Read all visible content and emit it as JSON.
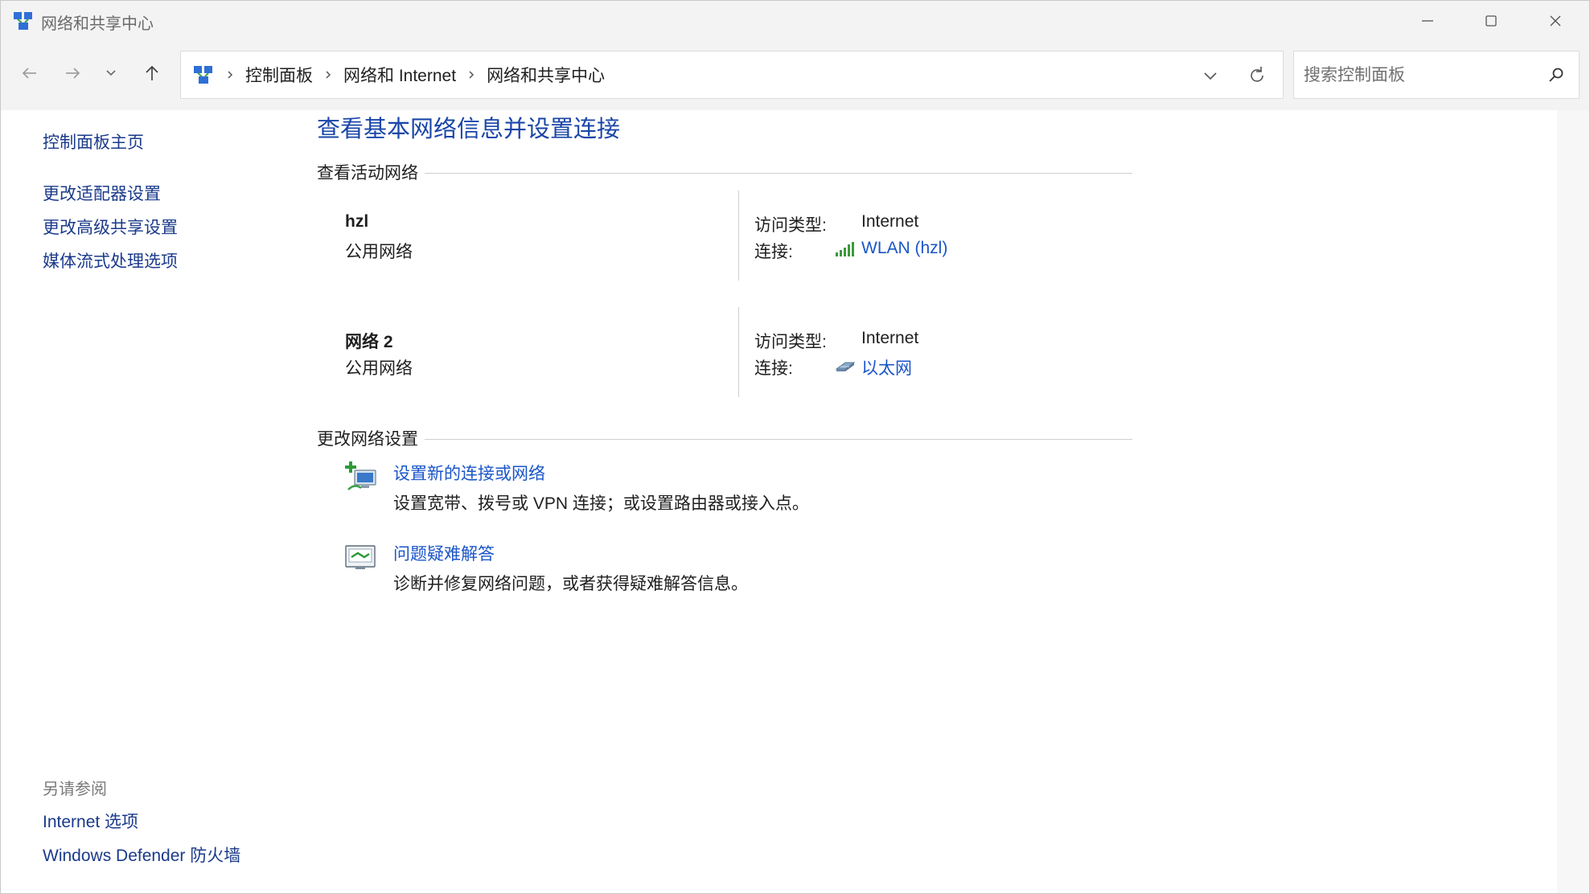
{
  "window": {
    "title": "网络和共享中心",
    "icon": "network-center-icon"
  },
  "navbar": {
    "back_icon": "arrow-left-icon",
    "forward_icon": "arrow-right-icon",
    "recent_icon": "chevron-down-icon",
    "up_icon": "arrow-up-icon",
    "breadcrumb": [
      "控制面板",
      "网络和 Internet",
      "网络和共享中心"
    ],
    "search": {
      "placeholder": "搜索控制面板",
      "value": ""
    }
  },
  "sidebar": {
    "home": "控制面板主页",
    "links": [
      "更改适配器设置",
      "更改高级共享设置",
      "媒体流式处理选项"
    ],
    "see_also_heading": "另请参阅",
    "see_also": [
      "Internet 选项",
      "Windows Defender 防火墙"
    ]
  },
  "main": {
    "title": "查看基本网络信息并设置连接",
    "active_networks_label": "查看活动网络",
    "networks": [
      {
        "name": "hzl",
        "type": "公用网络",
        "access_label": "访问类型:",
        "access_value": "Internet",
        "connection_label": "连接:",
        "connection_value": "WLAN (hzl)",
        "connection_icon": "wifi-signal-icon"
      },
      {
        "name": "网络 2",
        "type": "公用网络",
        "access_label": "访问类型:",
        "access_value": "Internet",
        "connection_label": "连接:",
        "connection_value": "以太网",
        "connection_icon": "ethernet-icon"
      }
    ],
    "change_settings_label": "更改网络设置",
    "tasks": [
      {
        "title": "设置新的连接或网络",
        "description": "设置宽带、拨号或 VPN 连接；或设置路由器或接入点。",
        "icon": "new-connection-icon"
      },
      {
        "title": "问题疑难解答",
        "description": "诊断并修复网络问题，或者获得疑难解答信息。",
        "icon": "troubleshoot-icon"
      }
    ]
  },
  "colors": {
    "link": "#1a55c8",
    "title": "#1a46a8",
    "sidebar_link": "#1a3a8a",
    "chrome": "#f3f3f3"
  }
}
